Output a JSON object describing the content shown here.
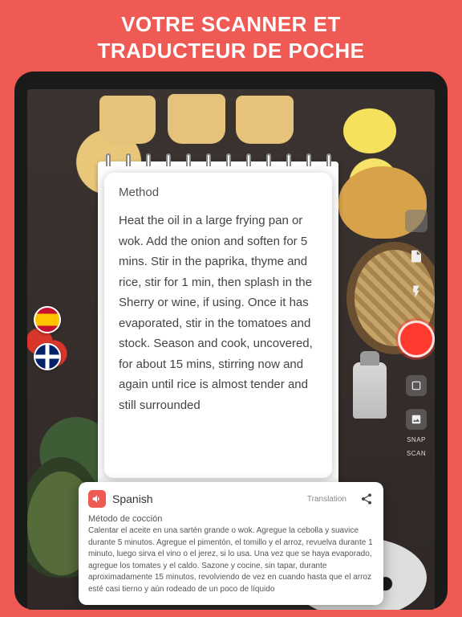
{
  "promo": {
    "headline_line1": "VOTRE SCANNER ET",
    "headline_line2": "TRADUCTEUR DE POCHE"
  },
  "scanned": {
    "heading": "Method",
    "body": "Heat the oil in a large frying pan or wok. Add the onion and soften for 5 mins. Stir in the paprika, thyme and rice, stir for 1 min, then splash in the Sherry or wine, if using. Once it has evaporated, stir in the tomatoes and stock. Season and cook, uncovered, for about 15 mins, stirring now and again until rice is almost tender and still surrounded"
  },
  "controls": {
    "mode_snap": "SNAP",
    "mode_scan": "SCAN"
  },
  "languages": {
    "source_flag": "es",
    "target_flag": "gb"
  },
  "translation": {
    "language_label": "Spanish",
    "section_label": "Translation",
    "title": "Método de cocción",
    "body": "Calentar el aceite en una sartén grande o wok. Agregue la cebolla y suavice durante 5 minutos. Agregue el pimentón, el tomillo y el arroz, revuelva durante 1 minuto, luego sirva el vino o el jerez, si lo usa. Una vez que se haya evaporado, agregue los tomates y el caldo. Sazone y cocine, sin tapar, durante aproximadamente 15 minutos, revolviendo de vez en cuando hasta que el arroz esté casi tierno y aún rodeado de un poco de líquido"
  }
}
